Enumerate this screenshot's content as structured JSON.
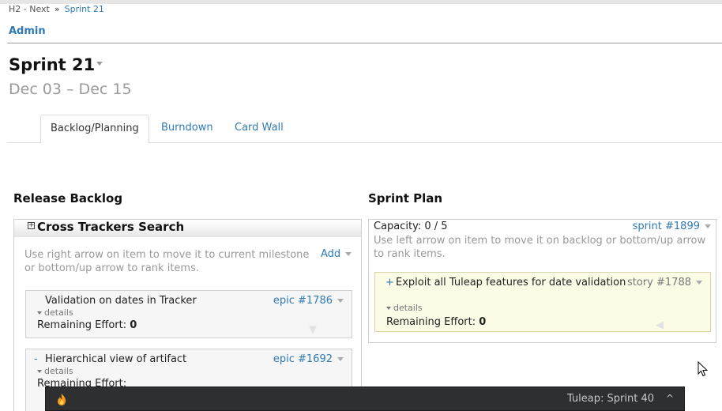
{
  "breadcrumb": {
    "items": [
      "H2 - Next",
      "Sprint 21"
    ],
    "separator": "»"
  },
  "header": {
    "admin_label": "Admin",
    "title": "Sprint 21",
    "dates": "Dec 03 – Dec 15"
  },
  "tabs": [
    {
      "label": "Backlog/Planning",
      "active": true
    },
    {
      "label": "Burndown",
      "active": false
    },
    {
      "label": "Card Wall",
      "active": false
    }
  ],
  "release_backlog": {
    "title": "Release Backlog",
    "cross_trackers": {
      "title": "Cross Trackers Search",
      "expander_icon": "plus-square-icon"
    },
    "help_text": "Use right arrow on item to move it to current milestone or bottom/up arrow to rank items.",
    "add_label": "Add",
    "items": [
      {
        "title": "Validation on dates in Tracker",
        "ref": "epic #1786",
        "details_label": "details",
        "effort_label": "Remaining Effort:",
        "effort_value": "0",
        "collapse_label": ""
      },
      {
        "title": "Hierarchical view of artifact",
        "ref": "epic #1692",
        "details_label": "details",
        "effort_label": "Remaining Effort:",
        "effort_value": "",
        "collapse_label": "-"
      }
    ]
  },
  "sprint_plan": {
    "title": "Sprint Plan",
    "capacity": "Capacity: 0 / 5",
    "ref": "sprint #1899",
    "help_text": "Use left arrow on item to move it on backlog or bottom/up arrow to rank items.",
    "items": [
      {
        "plus": "+",
        "title": "Exploit all Tuleap features for date validation",
        "ref": "story #1788",
        "details_label": "details",
        "effort_label": "Remaining Effort:",
        "effort_value": "0"
      }
    ]
  },
  "taskbar": {
    "window_title": "Tuleap: Sprint 40",
    "app_icon": "firefox-icon",
    "chevron": "^"
  },
  "colors": {
    "link": "#2f7ab5",
    "story_card_bg": "#fbfbe6",
    "taskbar_bg": "#2e2f31"
  }
}
